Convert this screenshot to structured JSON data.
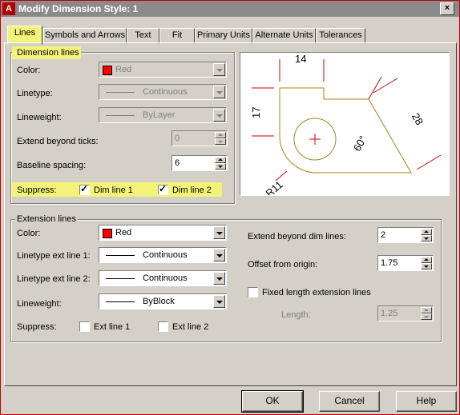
{
  "window": {
    "title": "Modify Dimension Style: 1",
    "app_icon_letter": "A",
    "close_symbol": "×"
  },
  "tabs": [
    "Lines",
    "Symbols and Arrows",
    "Text",
    "Fit",
    "Primary Units",
    "Alternate Units",
    "Tolerances"
  ],
  "active_tab": "Lines",
  "dimension_lines": {
    "title": "Dimension lines",
    "color_label": "Color:",
    "color_value": "Red",
    "color_swatch": "#ff0000",
    "linetype_label": "Linetype:",
    "linetype_value": "Continuous",
    "lineweight_label": "Lineweight:",
    "lineweight_value": "ByLayer",
    "extend_label": "Extend beyond ticks:",
    "extend_value": "0",
    "baseline_label": "Baseline spacing:",
    "baseline_value": "6",
    "suppress_label": "Suppress:",
    "dim_line1_label": "Dim line 1",
    "dim_line1_checked": true,
    "dim_line2_label": "Dim line 2",
    "dim_line2_checked": true
  },
  "preview": {
    "dim_top": "14",
    "dim_left": "17",
    "dim_right": "28",
    "dim_angle": "60°",
    "dim_radius": "R11"
  },
  "extension_lines": {
    "title": "Extension lines",
    "color_label": "Color:",
    "color_value": "Red",
    "color_swatch": "#ff0000",
    "lt1_label": "Linetype ext line 1:",
    "lt1_value": "Continuous",
    "lt2_label": "Linetype ext line 2:",
    "lt2_value": "Continuous",
    "lineweight_label": "Lineweight:",
    "lineweight_value": "ByBlock",
    "suppress_label": "Suppress:",
    "ext_line1_label": "Ext line 1",
    "ext_line1_checked": false,
    "ext_line2_label": "Ext line 2",
    "ext_line2_checked": false,
    "extend_label": "Extend beyond dim lines:",
    "extend_value": "2",
    "offset_label": "Offset from origin:",
    "offset_value": "1.75",
    "fixed_label": "Fixed length extension lines",
    "fixed_checked": false,
    "length_label": "Length:",
    "length_value": "1.25"
  },
  "buttons": {
    "ok": "OK",
    "cancel": "Cancel",
    "help": "Help"
  },
  "colors": {
    "highlight": "#f3f37a",
    "preview_lines": "#a0861a",
    "preview_dims": "#cc0000"
  }
}
